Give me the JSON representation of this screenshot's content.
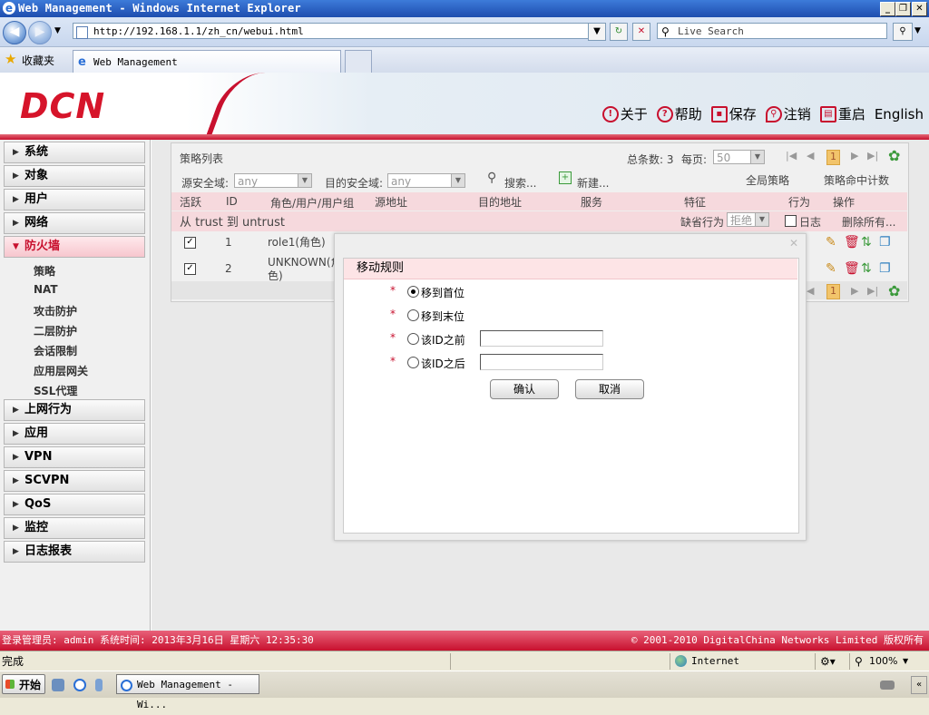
{
  "window": {
    "title": "Web Management - Windows Internet Explorer"
  },
  "address": {
    "url": "http://192.168.1.1/zh_cn/webui.html",
    "search_placeholder": "Live Search"
  },
  "favorites": {
    "label": "收藏夹",
    "tab_title": "Web Management"
  },
  "header": {
    "logo": "DCN",
    "nav": [
      {
        "label": "关于",
        "icon": "info-icon"
      },
      {
        "label": "帮助",
        "icon": "help-icon"
      },
      {
        "label": "保存",
        "icon": "save-icon"
      },
      {
        "label": "注销",
        "icon": "logout-icon"
      },
      {
        "label": "重启",
        "icon": "restart-icon"
      },
      {
        "label": "English",
        "icon": ""
      }
    ]
  },
  "sidebar": {
    "menus": [
      "系统",
      "对象",
      "用户",
      "网络",
      "防火墙",
      "上网行为",
      "应用",
      "VPN",
      "SCVPN",
      "QoS",
      "监控",
      "日志报表"
    ],
    "firewall_sub": [
      "策略",
      "NAT",
      "攻击防护",
      "二层防护",
      "会话限制",
      "应用层网关",
      "SSL代理"
    ]
  },
  "policy": {
    "title": "策略列表",
    "total_label": "总条数: 3",
    "per_page_label": "每页:",
    "per_page_value": "50",
    "page_current": "1",
    "src_zone_label": "源安全域:",
    "src_zone_value": "any",
    "dst_zone_label": "目的安全域:",
    "dst_zone_value": "any",
    "search_label": "搜索...",
    "new_label": "新建...",
    "global_policy": "全局策略",
    "hit_count": "策略命中计数",
    "columns": [
      "活跃",
      "ID",
      "角色/用户/用户组",
      "源地址",
      "目的地址",
      "服务",
      "特征",
      "行为",
      "操作"
    ],
    "zone_row": "从 trust 到 untrust",
    "default_action_label": "缺省行为",
    "default_action_value": "拒绝",
    "log_label": "日志",
    "delete_all": "删除所有...",
    "rows": [
      {
        "id": "1",
        "role": "role1(角色)"
      },
      {
        "id": "2",
        "role": "UNKNOWN(角",
        "role2": "色)"
      }
    ]
  },
  "dialog": {
    "title": "移动规则",
    "options": [
      "移到首位",
      "移到末位",
      "该ID之前",
      "该ID之后"
    ],
    "selected_index": 0,
    "ok": "确认",
    "cancel": "取消"
  },
  "footer": {
    "left": "登录管理员: admin 系统时间: 2013年3月16日 星期六 12:35:30",
    "right": "© 2001-2010 DigitalChina Networks Limited 版权所有"
  },
  "statusbar": {
    "status": "完成",
    "zone": "Internet",
    "zoom": "100%"
  },
  "taskbar": {
    "start": "开始",
    "task": "Web Management - Wi..."
  }
}
